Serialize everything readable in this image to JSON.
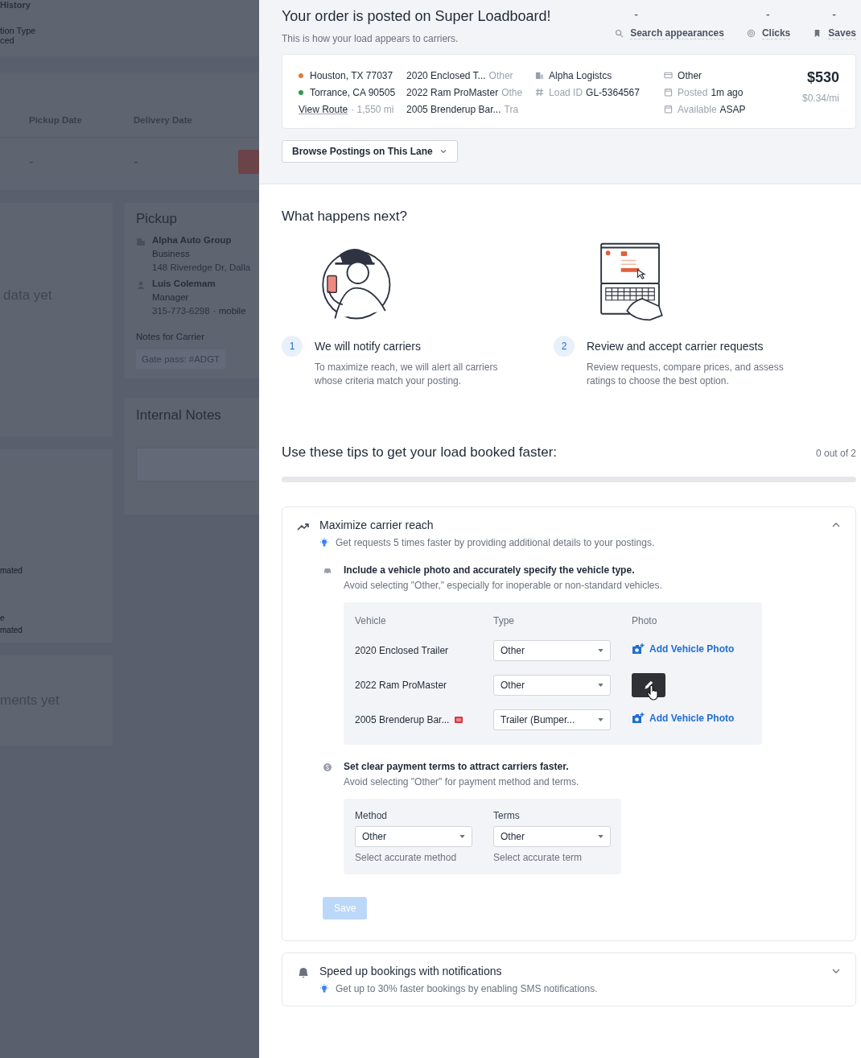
{
  "background": {
    "top_texts": [
      "History",
      "tion Type",
      "ced"
    ],
    "table": {
      "columns": [
        "Pickup Date",
        "Delivery Date"
      ],
      "cells": [
        "-",
        "-"
      ]
    },
    "empty_texts": [
      "data yet",
      "mated",
      "e",
      "mated",
      "ments yet"
    ],
    "pickup": {
      "title": "Pickup",
      "company": "Alpha Auto Group",
      "company_type": "Business",
      "address": "148 Riveredge Dr, Dalla",
      "contact": "Luis Colemam",
      "role": "Manager",
      "phone": "315-773-6298",
      "phone_type": "· mobile",
      "notes_label": "Notes for Carrier",
      "note": "Gate pass: #ADGT"
    },
    "internal_notes": {
      "title": "Internal Notes"
    }
  },
  "posting": {
    "title": "Your order is posted on Super Loadboard!",
    "subtitle": "This is how your load appears to carriers.",
    "stats": [
      {
        "value": "-",
        "label": "Search appearances"
      },
      {
        "value": "-",
        "label": "Clicks"
      },
      {
        "value": "-",
        "label": "Saves"
      }
    ],
    "card": {
      "stops": [
        {
          "place": "Houston, TX 77037",
          "color": "#e07b39"
        },
        {
          "place": "Torrance, CA 90505",
          "color": "#2f9a4a"
        }
      ],
      "route_link": "View Route",
      "distance": "· 1,550 mi",
      "vehicles": [
        {
          "name": "2020 Enclosed T...",
          "type": "Other"
        },
        {
          "name": "2022 Ram ProMaster",
          "type": "Othe"
        },
        {
          "name": "2005 Brenderup Bar...",
          "type": "Tra"
        }
      ],
      "company": "Alpha Logistcs",
      "load_id_label": "Load ID",
      "load_id": "GL-5364567",
      "details": [
        {
          "value": "Other"
        },
        {
          "label": "Posted",
          "value": "1m ago"
        },
        {
          "label": "Available",
          "value": "ASAP"
        }
      ],
      "price": "$530",
      "per_mile": "$0.34/mi"
    },
    "browse_button": "Browse Postings on This Lane"
  },
  "next": {
    "title": "What happens next?",
    "steps": [
      {
        "number": "1",
        "title": "We will notify carriers",
        "text": "To maximize reach, we will alert all carriers whose criteria match your posting."
      },
      {
        "number": "2",
        "title": "Review and accept carrier requests",
        "text": "Review requests, compare prices, and assess ratings to choose the best option."
      }
    ]
  },
  "tips": {
    "title": "Use these tips to get your load booked faster:",
    "progress_text": "0 out of 2",
    "level": 0,
    "sections": [
      {
        "title": "Maximize carrier reach",
        "hint": "Get requests 5 times faster by providing additional details to your postings.",
        "expanded": true,
        "vehicle_tip": {
          "title": "Include a vehicle photo and accurately specify the vehicle type.",
          "text": "Avoid selecting \"Other,\" especially for inoperable or non-standard vehicles.",
          "columns": [
            "Vehicle",
            "Type",
            "Photo"
          ],
          "rows": [
            {
              "vehicle": "2020 Enclosed Trailer",
              "flagged": false,
              "type": "Other",
              "photo": {
                "kind": "add",
                "label": "Add Vehicle Photo"
              }
            },
            {
              "vehicle": "2022 Ram ProMaster",
              "flagged": false,
              "type": "Other",
              "photo": {
                "kind": "thumbnail"
              }
            },
            {
              "vehicle": "2005 Brenderup Bar...",
              "flagged": true,
              "type": "Trailer (Bumper...",
              "photo": {
                "kind": "add",
                "label": "Add Vehicle Photo"
              }
            }
          ]
        },
        "payment_tip": {
          "title": "Set clear payment terms to attract carriers faster.",
          "text": "Avoid selecting \"Other\" for payment method and terms.",
          "fields": [
            {
              "label": "Method",
              "value": "Other",
              "hint": "Select accurate method"
            },
            {
              "label": "Terms",
              "value": "Other",
              "hint": "Select accurate term"
            }
          ]
        },
        "save_button": {
          "label": "Save",
          "disabled": true
        }
      },
      {
        "title": "Speed up bookings with notifications",
        "hint": "Get up to 30% faster bookings by enabling SMS notifications.",
        "expanded": false
      }
    ]
  }
}
